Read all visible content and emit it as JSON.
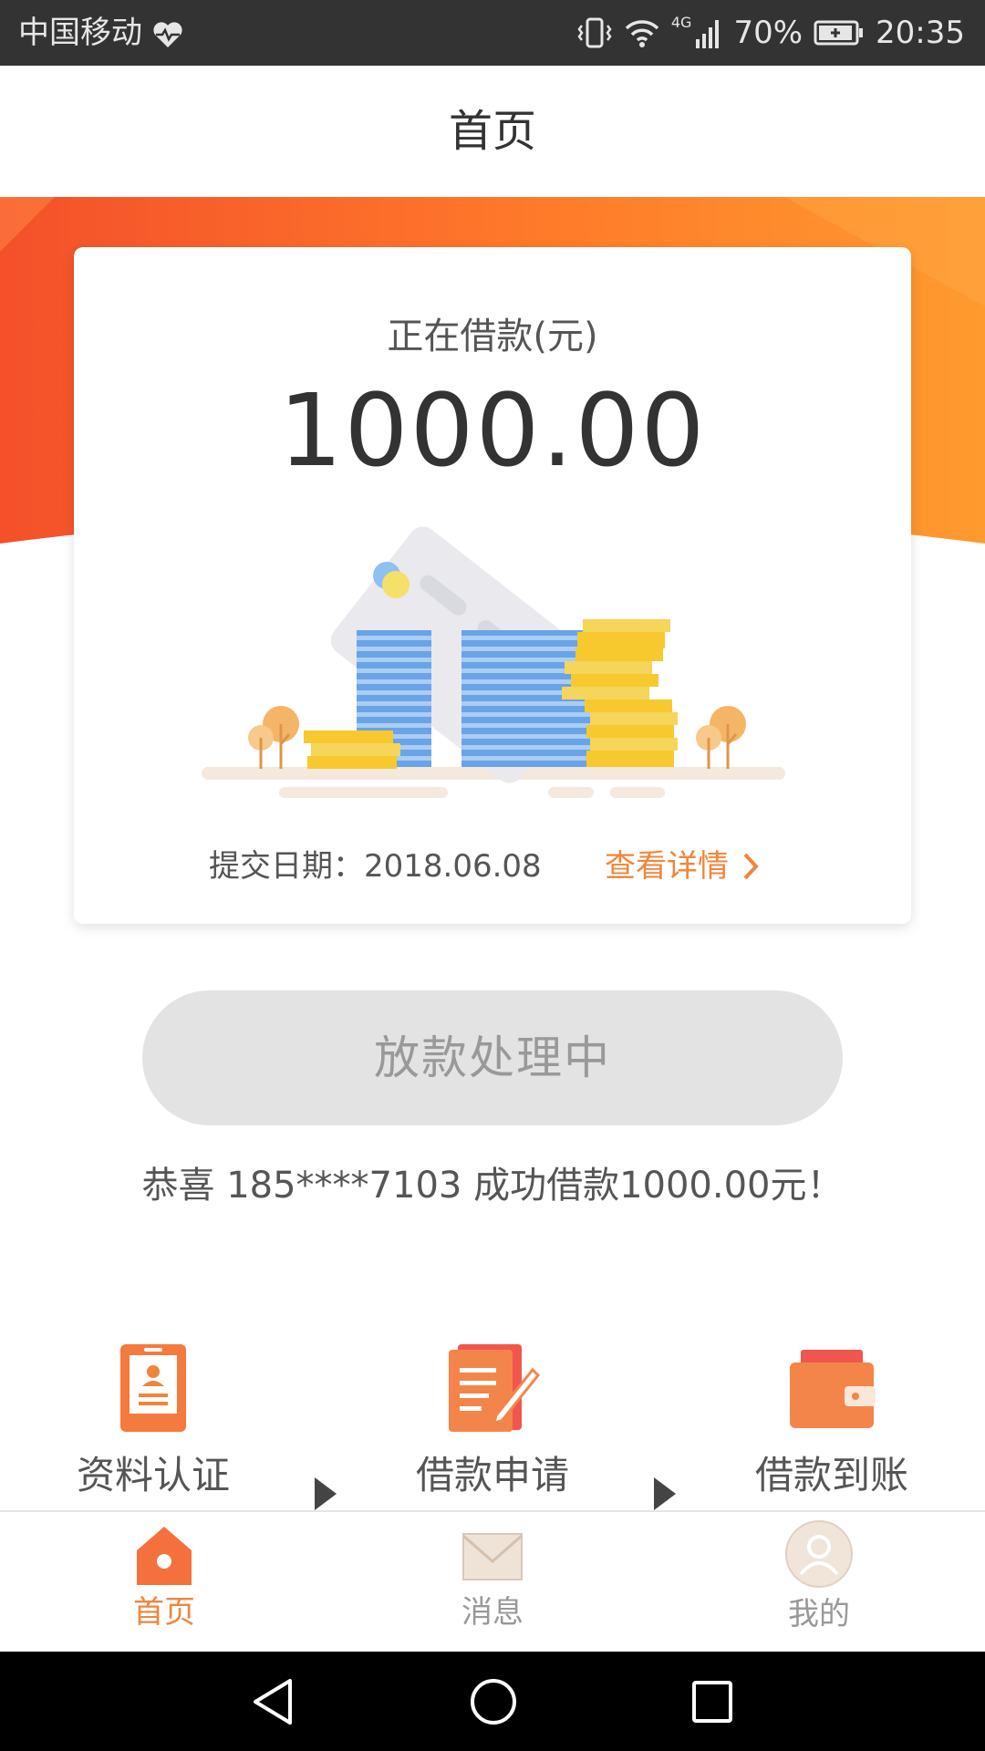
{
  "status_bar": {
    "carrier": "中国移动",
    "network": "4G",
    "battery": "70%",
    "time": "20:35",
    "icons": [
      "heart-monitor-icon",
      "vibrate-icon",
      "wifi-icon",
      "signal-icon",
      "battery-icon"
    ]
  },
  "header": {
    "title": "首页"
  },
  "loan_card": {
    "label": "正在借款(元)",
    "amount": "1000.00",
    "submit_date_label": "提交日期：",
    "submit_date": "2018.06.08",
    "detail_link": "查看详情"
  },
  "status_button": {
    "label": "放款处理中"
  },
  "congrats": {
    "text": "恭喜 185****7103 成功借款1000.00元！"
  },
  "steps": [
    {
      "label": "资料认证",
      "icon": "id-card-icon"
    },
    {
      "label": "借款申请",
      "icon": "document-edit-icon"
    },
    {
      "label": "借款到账",
      "icon": "wallet-icon"
    }
  ],
  "tabbar": {
    "items": [
      {
        "label": "首页",
        "icon": "home-icon",
        "active": true
      },
      {
        "label": "消息",
        "icon": "mail-icon",
        "active": false
      },
      {
        "label": "我的",
        "icon": "profile-icon",
        "active": false
      }
    ]
  },
  "colors": {
    "accent": "#f0853a",
    "banner_start": "#f55a2a",
    "banner_end": "#ff9a2e",
    "status_bar": "#333333",
    "button_disabled": "#e3e3e3"
  }
}
